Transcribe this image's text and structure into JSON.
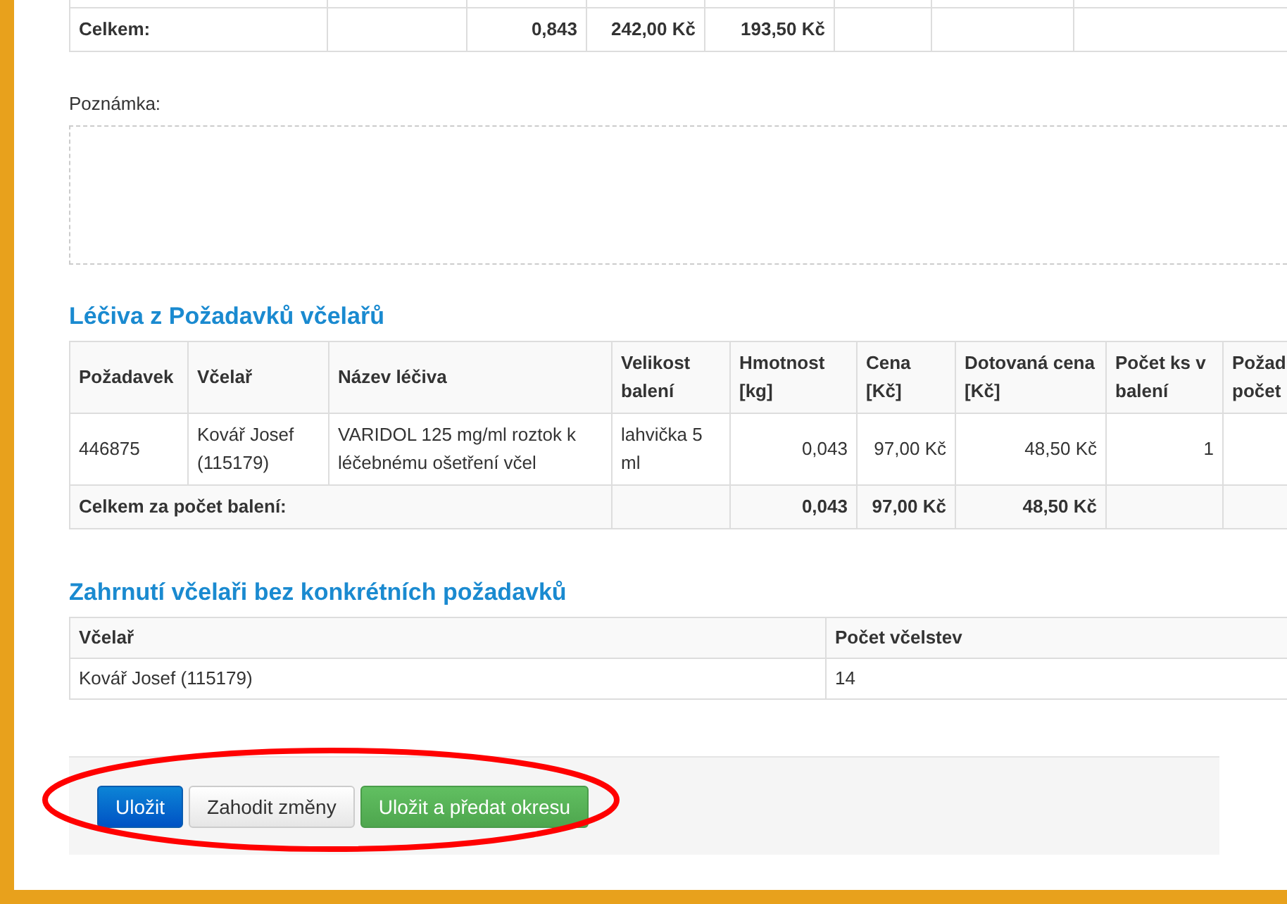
{
  "totals_table": {
    "footer": {
      "label": "Celkem:",
      "weight": "0,843",
      "price": "242,00 Kč",
      "subsidized_price": "193,50 Kč"
    }
  },
  "note": {
    "label": "Poznámka:"
  },
  "medicines": {
    "title": "Léčiva z Požadavků včelařů",
    "columns": [
      "Požadavek",
      "Včelař",
      "Název léčiva",
      "Velikost balení",
      "Hmotnost [kg]",
      "Cena [Kč]",
      "Dotovaná cena [Kč]",
      "Počet ks v balení",
      "Požad počet"
    ],
    "rows": [
      [
        "446875",
        "Kovář Josef (115179)",
        "VARIDOL 125 mg/ml roztok k léčebnému ošetření včel",
        "lahvička 5 ml",
        "0,043",
        "97,00 Kč",
        "48,50 Kč",
        "1"
      ]
    ],
    "footer": {
      "label": "Celkem za počet balení:",
      "weight": "0,043",
      "price": "97,00 Kč",
      "subsidized_price": "48,50 Kč"
    }
  },
  "beekeepers": {
    "title": "Zahrnutí včelaři bez konkrétních požadavků",
    "columns": [
      "Včelař",
      "Počet včelstev"
    ],
    "rows": [
      [
        "Kovář Josef (115179)",
        "14"
      ]
    ]
  },
  "actions": [
    {
      "label": "Uložit",
      "kind": "primary"
    },
    {
      "label": "Zahodit změny",
      "kind": "default"
    },
    {
      "label": "Uložit a předat okresu",
      "kind": "success"
    }
  ]
}
